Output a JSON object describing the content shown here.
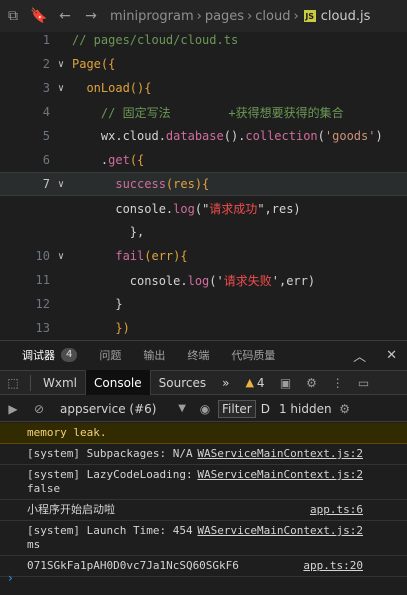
{
  "breadcrumb": {
    "items": [
      "miniprogram",
      "pages",
      "cloud"
    ],
    "file_badge": "JS",
    "file": "cloud.js"
  },
  "editor": {
    "lines": [
      {
        "num": "1",
        "fold": "",
        "segments": [
          {
            "t": "// pages/cloud/cloud.ts",
            "c": "c-comment"
          }
        ]
      },
      {
        "num": "2",
        "fold": "∨",
        "segments": [
          {
            "t": "Page({",
            "c": "c-kw"
          }
        ]
      },
      {
        "num": "3",
        "fold": "∨",
        "segments": [
          {
            "t": "  onLoad(){",
            "c": "c-kw"
          }
        ]
      },
      {
        "num": "4",
        "fold": "",
        "segments": [
          {
            "t": "    // 固定写法        +获得想要获得的集合",
            "c": "c-comment"
          }
        ]
      },
      {
        "num": "5",
        "fold": "",
        "segments": [
          {
            "t": "    wx.cloud.",
            "c": "c-white"
          },
          {
            "t": "database",
            "c": "c-pink"
          },
          {
            "t": "().",
            "c": "c-white"
          },
          {
            "t": "collection",
            "c": "c-pink"
          },
          {
            "t": "(",
            "c": "c-white"
          },
          {
            "t": "'goods'",
            "c": "c-str"
          },
          {
            "t": ")",
            "c": "c-white"
          }
        ]
      },
      {
        "num": "6",
        "fold": "",
        "segments": [
          {
            "t": "    .",
            "c": "c-white"
          },
          {
            "t": "get",
            "c": "c-pink"
          },
          {
            "t": "({",
            "c": "c-kw"
          }
        ]
      },
      {
        "num": "7",
        "fold": "∨",
        "segments": [
          {
            "t": "      success",
            "c": "c-pink"
          },
          {
            "t": "(res){",
            "c": "c-kw"
          }
        ]
      },
      {
        "num": "",
        "fold": "",
        "segments": [
          {
            "t": "      console.",
            "c": "c-white"
          },
          {
            "t": "log",
            "c": "c-pink"
          },
          {
            "t": "(\"",
            "c": "c-white"
          },
          {
            "t": "请求成功",
            "c": "c-red"
          },
          {
            "t": "\",res)",
            "c": "c-white"
          }
        ]
      },
      {
        "num": "",
        "fold": "",
        "segments": [
          {
            "t": "        },",
            "c": "c-white"
          }
        ]
      },
      {
        "num": "10",
        "fold": "∨",
        "segments": [
          {
            "t": "      fail",
            "c": "c-pink"
          },
          {
            "t": "(err){",
            "c": "c-kw"
          }
        ]
      },
      {
        "num": "11",
        "fold": "",
        "segments": [
          {
            "t": "        console.",
            "c": "c-white"
          },
          {
            "t": "log",
            "c": "c-pink"
          },
          {
            "t": "('",
            "c": "c-white"
          },
          {
            "t": "请求失败",
            "c": "c-red"
          },
          {
            "t": "',err)",
            "c": "c-white"
          }
        ]
      },
      {
        "num": "12",
        "fold": "",
        "segments": [
          {
            "t": "      }",
            "c": "c-white"
          }
        ]
      },
      {
        "num": "13",
        "fold": "",
        "segments": [
          {
            "t": "      })",
            "c": "c-kw"
          }
        ]
      }
    ]
  },
  "panel": {
    "tabs": [
      {
        "label": "调试器",
        "badge": "4",
        "active": true
      },
      {
        "label": "问题"
      },
      {
        "label": "输出"
      },
      {
        "label": "终端"
      },
      {
        "label": "代码质量"
      }
    ],
    "devtools_tabs": [
      "Wxml",
      "Console",
      "Sources"
    ],
    "active_devtools_tab": "Console",
    "warn_count": "4",
    "context": "appservice (#6)",
    "filter_label": "Filter",
    "filter_cut": "D",
    "hidden": "1 hidden"
  },
  "logs": [
    {
      "text": "memory leak.",
      "src": "",
      "type": "warn"
    },
    {
      "text": "[system] Subpackages: N/A",
      "src": "WAServiceMainContext.js:2",
      "type": "log"
    },
    {
      "text": "[system] LazyCodeLoading:\nfalse",
      "src": "WAServiceMainContext.js:2",
      "type": "log"
    },
    {
      "text": "小程序开始启动啦",
      "src": "app.ts:6",
      "type": "log"
    },
    {
      "text": "[system] Launch Time: 454\nms",
      "src": "WAServiceMainContext.js:2",
      "type": "log"
    },
    {
      "text": "071SGkFa1pAH0D0vc7Ja1NcSQ60SGkF6",
      "src": "app.ts:20",
      "type": "log"
    }
  ]
}
